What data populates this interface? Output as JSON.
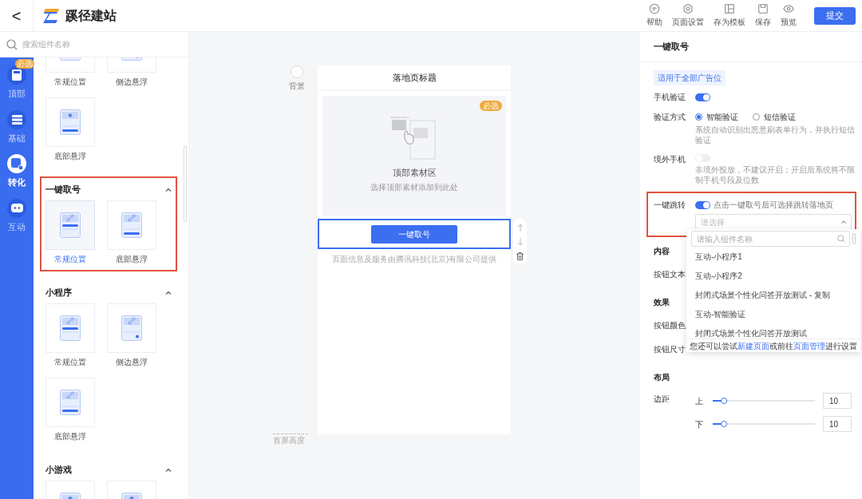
{
  "header": {
    "back": "<",
    "logo_text": "蹊径建站",
    "toolbar": [
      {
        "kind": "help",
        "label": "帮助"
      },
      {
        "kind": "settings",
        "label": "页面设置"
      },
      {
        "kind": "template",
        "label": "存为模板"
      },
      {
        "kind": "save",
        "label": "保存"
      },
      {
        "kind": "preview",
        "label": "预览"
      }
    ],
    "submit": "提交"
  },
  "rail": [
    {
      "kind": "top",
      "label": "顶部",
      "badge": "必选",
      "selected": false
    },
    {
      "kind": "basic",
      "label": "基础",
      "selected": false
    },
    {
      "kind": "convert",
      "label": "转化",
      "selected": true
    },
    {
      "kind": "interact",
      "label": "互动",
      "selected": false
    }
  ],
  "component_panel": {
    "search_placeholder": "搜索组件名称",
    "groups": [
      {
        "kind": "picture",
        "highlighted": false,
        "items": [
          {
            "label": "常规位置",
            "kind": "middle",
            "selected": false
          },
          {
            "label": "侧边悬浮",
            "kind": "side",
            "selected": false
          },
          {
            "label": "底部悬浮",
            "kind": "bottom",
            "selected": false
          }
        ]
      },
      {
        "kind": "link",
        "title": "一键取号",
        "expanded": true,
        "highlighted": true,
        "items": [
          {
            "label": "常规位置",
            "kind": "middle",
            "selected": true
          },
          {
            "label": "底部悬浮",
            "kind": "bottom",
            "selected": false
          }
        ]
      },
      {
        "kind": "link",
        "title": "小程序",
        "expanded": true,
        "highlighted": false,
        "items": [
          {
            "label": "常规位置",
            "kind": "middle",
            "selected": false
          },
          {
            "label": "侧边悬浮",
            "kind": "side",
            "selected": false
          },
          {
            "label": "底部悬浮",
            "kind": "bottom",
            "selected": false
          }
        ]
      },
      {
        "kind": "game",
        "title": "小游戏",
        "expanded": true,
        "highlighted": false,
        "items": [
          {
            "kind": "middle",
            "selected": false
          },
          {
            "kind": "side",
            "selected": false
          }
        ]
      }
    ]
  },
  "canvas": {
    "background_label": "背景",
    "page_title": "落地页标题",
    "material": {
      "badge": "必选",
      "title": "顶部素材区",
      "hint": "选择顶部素材添加到此处"
    },
    "button": {
      "label": "一键取号",
      "selected": true
    },
    "footer": "页面信息及服务由腾讯科技(北京)有限公司提供",
    "fold_label": "首屏高度"
  },
  "settings": {
    "title": "一键取号",
    "scope_tag": "适用于全部广告位",
    "phone_verify": {
      "label": "手机验证",
      "on": true
    },
    "verify_method": {
      "label": "验证方式",
      "options": [
        {
          "label": "智能验证",
          "selected": true
        },
        {
          "label": "短信验证",
          "selected": false
        }
      ],
      "hint": "系统自动识别出恶意刷表单行为，并执行短信验证"
    },
    "overseas": {
      "label": "境外手机",
      "on": false,
      "hint": "非境外投放，不建议开启；开启后系统将不限制手机号段及位数"
    },
    "jump": {
      "label": "一键跳转",
      "on": true,
      "hint": "点击一键取号后可选择跳转落地页",
      "select_placeholder": "请选择",
      "highlighted": true,
      "dropdown": {
        "search_placeholder": "请输入组件名称",
        "options": [
          "互动-小程序1",
          "互动-小程序2",
          "封闭式场景个性化问答开放测试 - 复制",
          "互动-智能验证",
          "封闭式场景个性化问答开放测试"
        ],
        "footer": [
          "您还可以尝试",
          "新建页面",
          "或前往",
          "页面管理",
          "进行设置"
        ]
      }
    },
    "content_heading": "内容",
    "button_text_label": "按钮文本",
    "effect_heading": "效果",
    "button_color_label": "按钮颜色",
    "button_size_label": "按钮尺寸",
    "layout_heading": "布局",
    "margin_label": "边距",
    "margins": [
      {
        "label": "上",
        "level": 0.11,
        "value": "10"
      },
      {
        "label": "下",
        "level": 0.11,
        "value": "10"
      }
    ]
  }
}
